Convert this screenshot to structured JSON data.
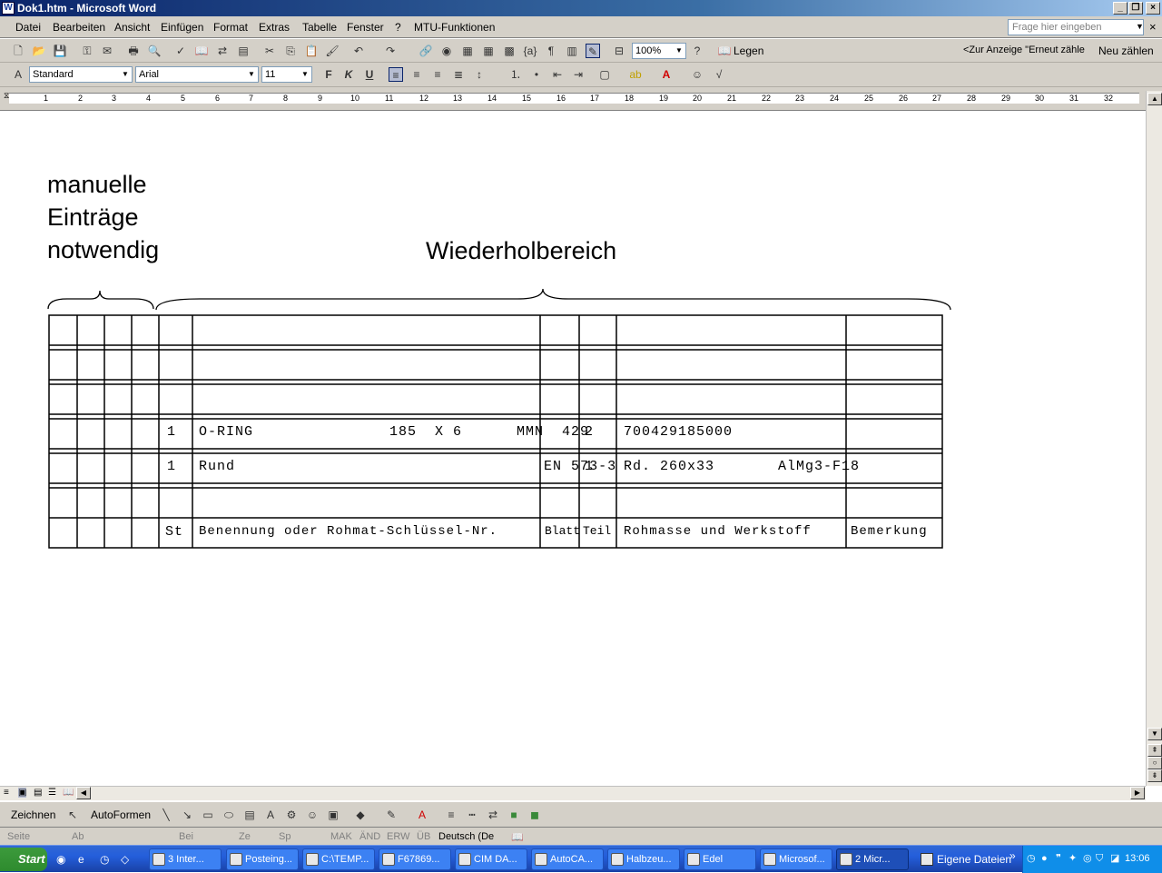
{
  "window": {
    "title": "Dok1.htm - Microsoft Word"
  },
  "menubar": {
    "items": [
      "Datei",
      "Bearbeiten",
      "Ansicht",
      "Einfügen",
      "Format",
      "Extras",
      "Tabelle",
      "Fenster",
      "?",
      "MTU-Funktionen"
    ],
    "help_placeholder": "Frage hier eingeben"
  },
  "toolbar": {
    "zoom": "100%",
    "read_label": "Legen",
    "recount_select": "<Zur Anzeige \"Erneut zähle",
    "recount_button": "Neu zählen"
  },
  "format": {
    "style": "Standard",
    "font": "Arial",
    "size": "11",
    "bold": "F",
    "italic": "K",
    "underline": "U"
  },
  "ruler": {
    "marks": [
      "1",
      "2",
      "3",
      "4",
      "5",
      "6",
      "7",
      "8",
      "9",
      "10",
      "11",
      "12",
      "13",
      "14",
      "15",
      "16",
      "17",
      "18",
      "19",
      "20",
      "21",
      "22",
      "23",
      "24",
      "25",
      "26",
      "27",
      "28",
      "29",
      "30",
      "31",
      "32"
    ]
  },
  "document": {
    "note_lines": [
      "manuelle",
      "Einträge",
      "notwendig"
    ],
    "repeat_label": "Wiederholbereich",
    "rows": [
      {
        "c4": "",
        "c5": "",
        "c6": "",
        "c7": "",
        "c8": "",
        "c9": ""
      },
      {
        "c4": "",
        "c5": "",
        "c6": "",
        "c7": "",
        "c8": "",
        "c9": ""
      },
      {
        "c4": "",
        "c5": "",
        "c6": "",
        "c7": "",
        "c8": "",
        "c9": ""
      },
      {
        "c4": "1",
        "c5": "O-RING               185  X 6      MMN  429",
        "c6": "",
        "c7": "2",
        "c8": "700429185000",
        "c9": ""
      },
      {
        "c4": "1",
        "c5": "Rund                                  EN 573-3",
        "c6": "",
        "c7": "1",
        "c8": "Rd. 260x33       AlMg3-F18",
        "c9": ""
      },
      {
        "c4": "",
        "c5": "",
        "c6": "",
        "c7": "",
        "c8": "",
        "c9": ""
      }
    ],
    "header": {
      "c4": "St",
      "c5": "Benennung oder Rohmat-Schlüssel-Nr.",
      "c6": "Blatt",
      "c7": "Teil",
      "c8": "Rohmasse und Werkstoff",
      "c9": "Bemerkung"
    }
  },
  "drawing": {
    "draw_label": "Zeichnen",
    "autoshapes_label": "AutoFormen"
  },
  "status": {
    "items": [
      "Seite",
      "Ab",
      "Bei",
      "Ze",
      "Sp",
      "MAK",
      "ÄND",
      "ERW",
      "ÜB",
      "Deutsch (De"
    ]
  },
  "taskbar": {
    "start_label": "Start",
    "tasks": [
      "3 Inter...",
      "Posteing...",
      "C:\\TEMP...",
      "F67869...",
      "CIM DA...",
      "AutoCA...",
      "Halbzeu...",
      "Edel",
      "Microsof...",
      "2 Micr..."
    ],
    "desktop_label": "Eigene Dateien",
    "clock": "13:06"
  }
}
